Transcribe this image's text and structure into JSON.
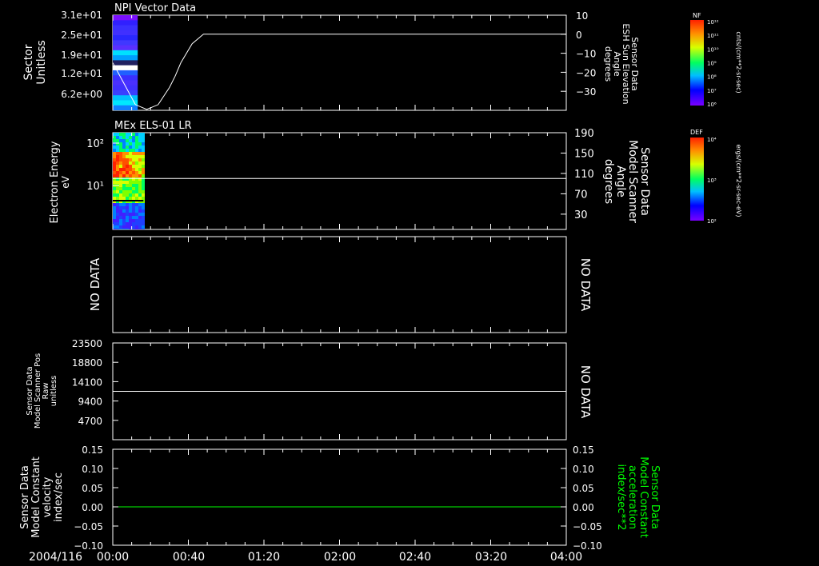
{
  "chart_data": [
    {
      "type": "heatmap",
      "title": "NPI Vector Data",
      "ylabel": [
        "Sector",
        "Unitless"
      ],
      "yticks": [
        "3.1e+01",
        "2.5e+01",
        "1.9e+01",
        "1.2e+01",
        "6.2e+00"
      ],
      "spectrogram_extent_hours": [
        0,
        0.22
      ],
      "right_axis": {
        "label": [
          "Sensor Data",
          "ESH Sun Elevation",
          "Angle",
          "degrees"
        ],
        "ticks": [
          10,
          0,
          -10,
          -20,
          -30
        ],
        "ylim": [
          -40,
          10
        ]
      },
      "series": [
        {
          "color": "#ffffff",
          "x": [
            0,
            0.1,
            0.2,
            0.3,
            0.4,
            0.5,
            0.55,
            0.6,
            0.7,
            0.8,
            0.9,
            1.0,
            4.0
          ],
          "y": [
            -15,
            -26,
            -37,
            -39.5,
            -37,
            -28,
            -22,
            -15,
            -5,
            0,
            0,
            0,
            0
          ]
        }
      ],
      "colorbar": {
        "label": "NF",
        "units": "cnts/(cm**2-sr-sec)",
        "ticks": [
          "10¹²",
          "10¹¹",
          "10¹⁰",
          "10⁹",
          "10⁸",
          "10⁷",
          "10⁶"
        ]
      }
    },
    {
      "type": "heatmap",
      "title": "MEx ELS-01 LR",
      "ylabel": [
        "Electron Energy",
        "eV"
      ],
      "yticks": [
        "10²",
        "10¹"
      ],
      "spectrogram_extent_hours": [
        0,
        0.27
      ],
      "right_axis": {
        "label": [
          "Sensor Data",
          "Model Scanner",
          "Angle",
          "degrees"
        ],
        "ticks": [
          190,
          150,
          110,
          70,
          30
        ],
        "ylim": [
          0,
          190
        ]
      },
      "series": [
        {
          "color": "#ffffff",
          "x": [
            0,
            4.0
          ],
          "y": [
            100,
            100
          ]
        }
      ],
      "colorbar": {
        "label": "DEF",
        "units": "ergs/(cm**2-sr-sec-eV)",
        "ticks": [
          "10⁴",
          "10³",
          "10²"
        ]
      }
    },
    {
      "type": "line",
      "left_label": "NO DATA",
      "right_label": "NO DATA"
    },
    {
      "type": "line",
      "ylabel": [
        "Sensor Data",
        "Model Scanner Pos",
        "Raw",
        "unitless"
      ],
      "yticks": [
        23500,
        18800,
        14100,
        9400,
        4700
      ],
      "ylim": [
        0,
        23500
      ],
      "series": [
        {
          "color": "#ffffff",
          "x": [
            0,
            4.0
          ],
          "y": [
            11750,
            11750
          ]
        }
      ],
      "right_label": "NO DATA"
    },
    {
      "type": "line",
      "ylabel": [
        "Sensor Data",
        "Model Constant",
        "velocity",
        "index/sec"
      ],
      "yticks": [
        "0.15",
        "0.10",
        "0.05",
        "0.00",
        "-0.05",
        "-0.10"
      ],
      "ylim": [
        -0.1,
        0.15
      ],
      "right_ylabel": [
        "Sensor Data",
        "Model Constant",
        "acceleration",
        "index/sec**2"
      ],
      "right_ylabel_color": "#00ff00",
      "series": [
        {
          "color": "#00ff00",
          "x": [
            0,
            4.0
          ],
          "y": [
            0,
            0
          ]
        }
      ]
    }
  ],
  "x_axis": {
    "date_label": "2004/116",
    "ticks": [
      "00:00",
      "00:40",
      "01:20",
      "02:00",
      "02:40",
      "03:20",
      "04:00"
    ],
    "xlim_hours": [
      0,
      4.0
    ]
  }
}
